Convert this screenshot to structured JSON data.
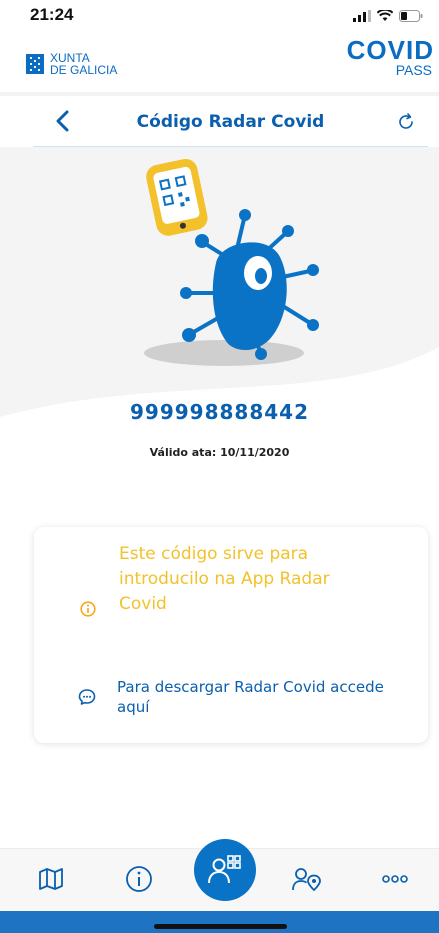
{
  "status_bar": {
    "time": "21:24"
  },
  "brand": {
    "xunta_line1": "XUNTA",
    "xunta_line2": "DE GALICIA",
    "app_logo_word": "COVID",
    "app_logo_sub": "PASS"
  },
  "nav": {
    "title": "Código Radar Covid"
  },
  "code": {
    "value": "999998888442",
    "valid_text": "Válido ata: 10/11/2020"
  },
  "card": {
    "info_text": "Este código sirve para introducilo na App Radar Covid",
    "link_text": "Para descargar Radar Covid accede aquí"
  },
  "icons": {
    "back": "chevron-left-icon",
    "refresh": "refresh-icon",
    "info": "info-icon",
    "chat": "chat-bubble-icon",
    "map": "map-icon",
    "info_tab": "info-circle-icon",
    "qr_user": "user-qr-icon",
    "user_location": "user-location-icon",
    "more": "more-dots-icon"
  },
  "colors": {
    "primary": "#0a5fae",
    "accent_blue": "#0b73c6",
    "yellow": "#f3c12b"
  }
}
